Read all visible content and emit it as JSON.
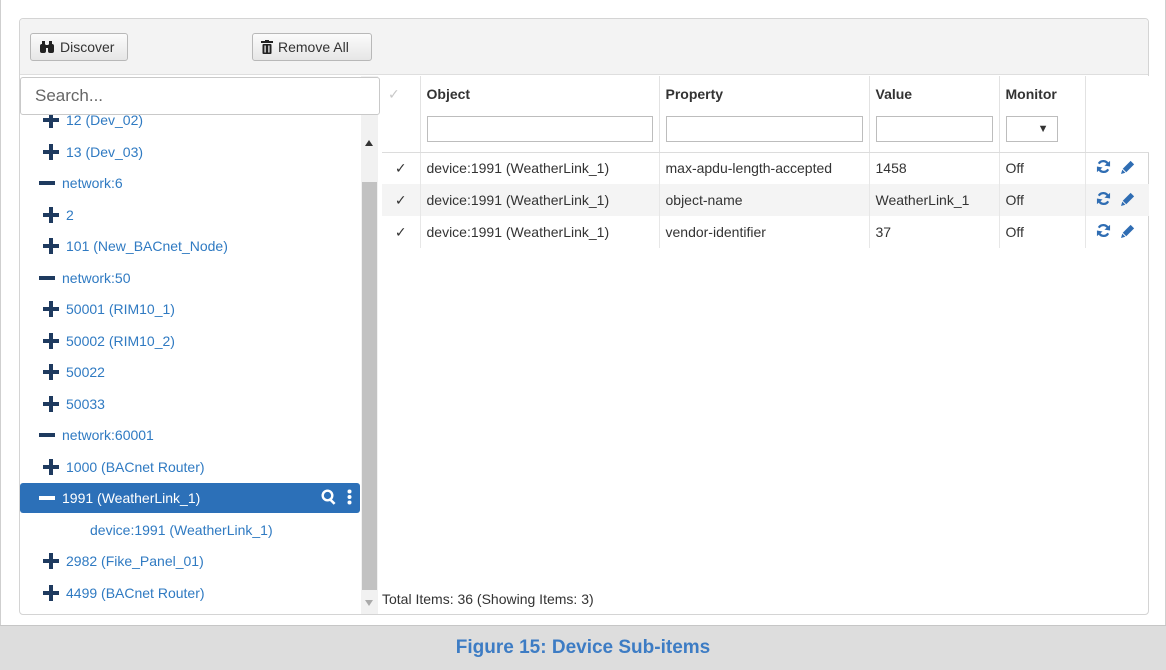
{
  "toolbar": {
    "discover_label": "Discover",
    "remove_all_label": "Remove All"
  },
  "search": {
    "placeholder": "Search..."
  },
  "tree": {
    "items": [
      {
        "label": "12 (Dev_02)",
        "type": "plus",
        "indent": 1
      },
      {
        "label": "13 (Dev_03)",
        "type": "plus",
        "indent": 1
      },
      {
        "label": "network:6",
        "type": "minus",
        "indent": 0
      },
      {
        "label": "2",
        "type": "plus",
        "indent": 1
      },
      {
        "label": "101 (New_BACnet_Node)",
        "type": "plus",
        "indent": 1
      },
      {
        "label": "network:50",
        "type": "minus",
        "indent": 0
      },
      {
        "label": "50001 (RIM10_1)",
        "type": "plus",
        "indent": 1
      },
      {
        "label": "50002 (RIM10_2)",
        "type": "plus",
        "indent": 1
      },
      {
        "label": "50022",
        "type": "plus",
        "indent": 1
      },
      {
        "label": "50033",
        "type": "plus",
        "indent": 1
      },
      {
        "label": "network:60001",
        "type": "minus",
        "indent": 0
      },
      {
        "label": "1000 (BACnet Router)",
        "type": "plus",
        "indent": 1
      },
      {
        "label": "1991 (WeatherLink_1)",
        "type": "minus",
        "indent": 0,
        "selected": true
      },
      {
        "label": "device:1991 (WeatherLink_1)",
        "type": "none",
        "indent": 2
      },
      {
        "label": "2982 (Fike_Panel_01)",
        "type": "plus",
        "indent": 1
      },
      {
        "label": "4499 (BACnet Router)",
        "type": "plus",
        "indent": 1
      }
    ]
  },
  "grid": {
    "columns": {
      "object": "Object",
      "property": "Property",
      "value": "Value",
      "monitor": "Monitor"
    },
    "rows": [
      {
        "object": "device:1991 (WeatherLink_1)",
        "property": "max-apdu-length-accepted",
        "value": "1458",
        "monitor": "Off"
      },
      {
        "object": "device:1991 (WeatherLink_1)",
        "property": "object-name",
        "value": "WeatherLink_1",
        "monitor": "Off"
      },
      {
        "object": "device:1991 (WeatherLink_1)",
        "property": "vendor-identifier",
        "value": "37",
        "monitor": "Off"
      }
    ],
    "footer": "Total Items: 36 (Showing Items: 3)"
  },
  "caption": "Figure 15: Device Sub-items",
  "colors": {
    "accent": "#2c70b8",
    "link": "#2f7ac2",
    "caption": "#3d7cc4"
  }
}
